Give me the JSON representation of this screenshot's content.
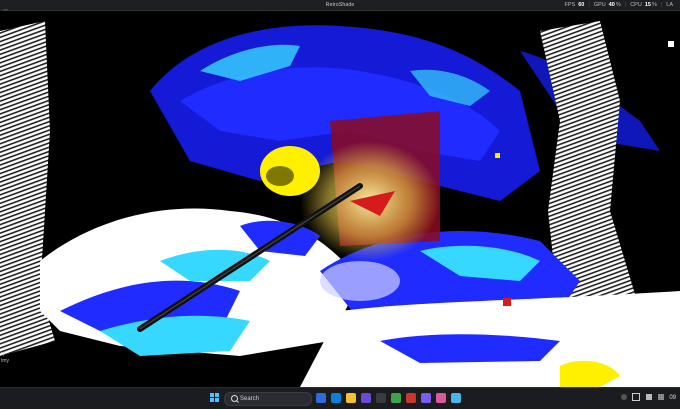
{
  "window": {
    "title": "RetroShade"
  },
  "perf_hud": {
    "fps_label": "FPS",
    "fps_value": "60",
    "gpu_label": "GPU",
    "gpu_value": "40",
    "gpu_unit": "%",
    "cpu_label": "CPU",
    "cpu_value": "15",
    "cpu_unit": "%",
    "lat_label": "LA"
  },
  "left_edge": {
    "line1": "ry",
    "line2": "tmy"
  },
  "taskbar": {
    "search_placeholder": "Search",
    "time": "09"
  },
  "colors": {
    "accent_blue": "#1f2bff",
    "cyan": "#36d8ff",
    "yellow": "#fff000",
    "dark_red": "#8b0a1e",
    "taskbar_bg": "#1b1c20"
  }
}
